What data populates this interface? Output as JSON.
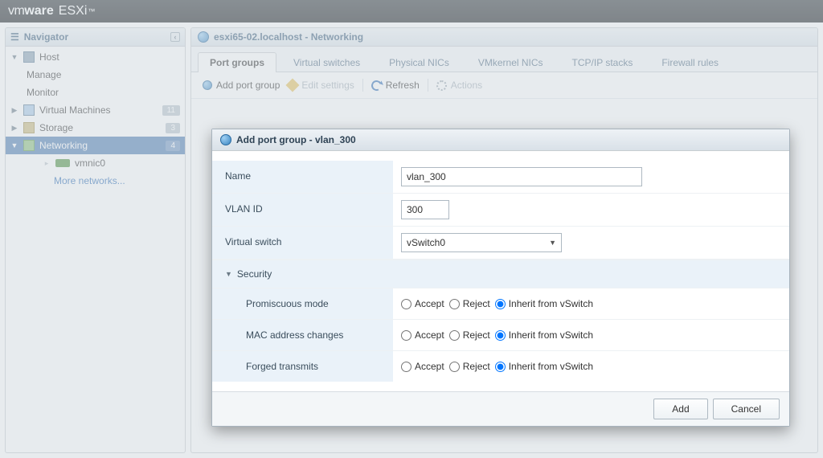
{
  "brand": {
    "vm": "vm",
    "ware": "ware",
    "product": "ESXi",
    "tm": "™"
  },
  "navigator": {
    "title": "Navigator",
    "host": "Host",
    "manage": "Manage",
    "monitor": "Monitor",
    "vms": {
      "label": "Virtual Machines",
      "count": "11"
    },
    "storage": {
      "label": "Storage",
      "count": "3"
    },
    "networking": {
      "label": "Networking",
      "count": "4"
    },
    "nic": "vmnic0",
    "more": "More networks..."
  },
  "page": {
    "title": "esxi65-02.localhost - Networking",
    "tabs": [
      "Port groups",
      "Virtual switches",
      "Physical NICs",
      "VMkernel NICs",
      "TCP/IP stacks",
      "Firewall rules"
    ],
    "toolbar": {
      "add": "Add port group",
      "edit": "Edit settings",
      "refresh": "Refresh",
      "actions": "Actions"
    }
  },
  "dialog": {
    "title": "Add port group - vlan_300",
    "name_label": "Name",
    "name_value": "vlan_300",
    "vlan_label": "VLAN ID",
    "vlan_value": "300",
    "vswitch_label": "Virtual switch",
    "vswitch_value": "vSwitch0",
    "security": "Security",
    "promiscuous": "Promiscuous mode",
    "mac": "MAC address changes",
    "forged": "Forged transmits",
    "accept": "Accept",
    "reject": "Reject",
    "inherit": "Inherit from vSwitch",
    "add_btn": "Add",
    "cancel_btn": "Cancel"
  }
}
